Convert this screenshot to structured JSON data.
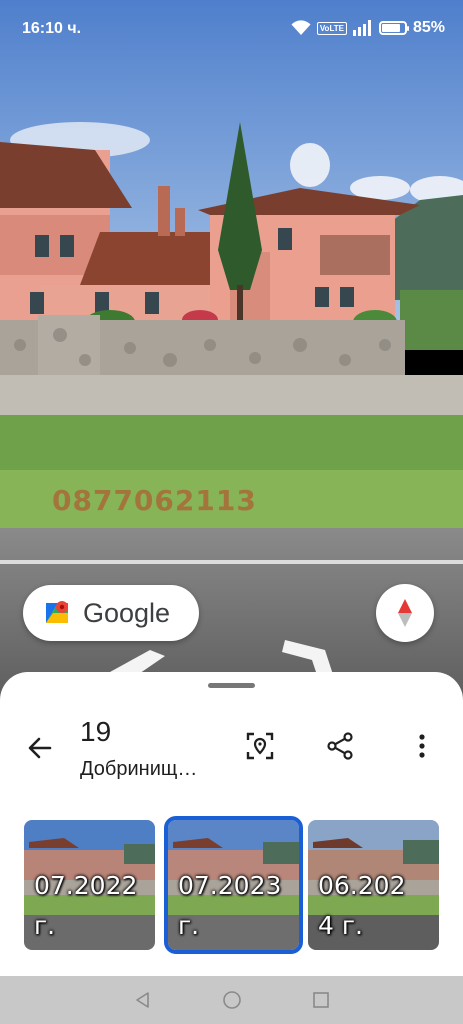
{
  "status_bar": {
    "time": "16:10 ч.",
    "volte": "VoLTE",
    "battery_percent": "85%",
    "battery_level": 0.85
  },
  "map_overlay": {
    "watermark": "0877062113",
    "google_label": "Google"
  },
  "sheet": {
    "title_number": "19",
    "title_place": "Добринищ…"
  },
  "thumbnails": [
    {
      "date_line1": "07.2022",
      "date_line2": "г.",
      "selected": false
    },
    {
      "date_line1": "07.2023",
      "date_line2": "г.",
      "selected": true
    },
    {
      "date_line1": "06.202",
      "date_line2": "4 г.",
      "selected": false
    }
  ],
  "colors": {
    "selection_accent": "#1a5fd6",
    "sheet_background": "#ffffff",
    "nav_background": "#c8c8c8"
  },
  "icons": {
    "back": "arrow-back-icon",
    "focus": "location-focus-icon",
    "share": "share-icon",
    "more": "more-vert-icon",
    "compass": "compass-icon",
    "maps_logo": "google-maps-logo-icon"
  }
}
